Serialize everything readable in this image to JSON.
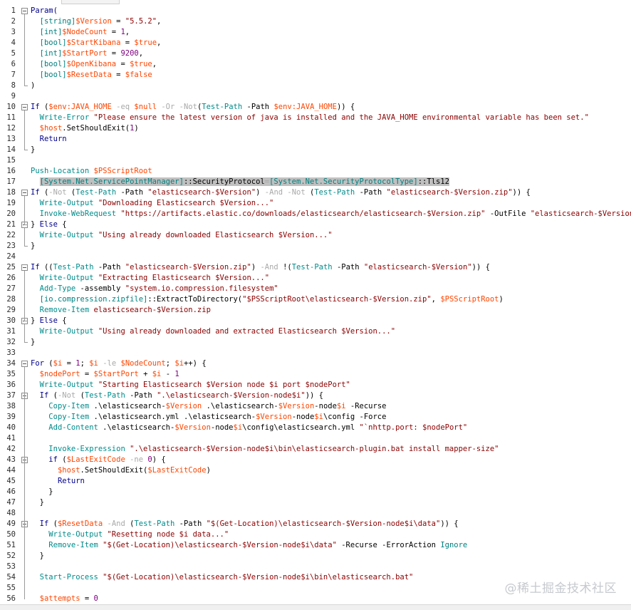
{
  "watermark": "@稀土掘金技术社区",
  "lines": [
    {
      "n": "1",
      "t": [
        [
          "Param(",
          "kw"
        ]
      ]
    },
    {
      "n": "2",
      "t": [
        [
          "  ",
          ""
        ],
        [
          "[string]",
          "typ"
        ],
        [
          "$Version",
          "var"
        ],
        [
          " = ",
          ""
        ],
        [
          "\"5.5.2\"",
          "str"
        ],
        [
          ",",
          ""
        ]
      ]
    },
    {
      "n": "3",
      "t": [
        [
          "  ",
          ""
        ],
        [
          "[int]",
          "typ"
        ],
        [
          "$NodeCount",
          "var"
        ],
        [
          " = ",
          ""
        ],
        [
          "1",
          "num"
        ],
        [
          ",",
          ""
        ]
      ]
    },
    {
      "n": "4",
      "t": [
        [
          "  ",
          ""
        ],
        [
          "[bool]",
          "typ"
        ],
        [
          "$StartKibana",
          "var"
        ],
        [
          " = ",
          ""
        ],
        [
          "$true",
          "var"
        ],
        [
          ",",
          ""
        ]
      ]
    },
    {
      "n": "5",
      "t": [
        [
          "  ",
          ""
        ],
        [
          "[int]",
          "typ"
        ],
        [
          "$StartPort",
          "var"
        ],
        [
          " = ",
          ""
        ],
        [
          "9200",
          "num"
        ],
        [
          ",",
          ""
        ]
      ]
    },
    {
      "n": "6",
      "t": [
        [
          "  ",
          ""
        ],
        [
          "[bool]",
          "typ"
        ],
        [
          "$OpenKibana",
          "var"
        ],
        [
          " = ",
          ""
        ],
        [
          "$true",
          "var"
        ],
        [
          ",",
          ""
        ]
      ]
    },
    {
      "n": "7",
      "t": [
        [
          "  ",
          ""
        ],
        [
          "[bool]",
          "typ"
        ],
        [
          "$ResetData",
          "var"
        ],
        [
          " = ",
          ""
        ],
        [
          "$false",
          "var"
        ]
      ]
    },
    {
      "n": "8",
      "t": [
        [
          ")",
          ""
        ]
      ]
    },
    {
      "n": "9",
      "t": []
    },
    {
      "n": "10",
      "t": [
        [
          "If ",
          "kw"
        ],
        [
          "(",
          ""
        ],
        [
          "$env:JAVA_HOME",
          "var"
        ],
        [
          " -eq ",
          "op"
        ],
        [
          "$null",
          "var"
        ],
        [
          " -Or -Not",
          "op"
        ],
        [
          "(",
          ""
        ],
        [
          "Test-Path",
          "cm"
        ],
        [
          " -Path ",
          ""
        ],
        [
          "$env:JAVA_HOME",
          "var"
        ],
        [
          ")) {",
          ""
        ]
      ]
    },
    {
      "n": "11",
      "t": [
        [
          "  ",
          ""
        ],
        [
          "Write-Error",
          "cm"
        ],
        [
          " ",
          ""
        ],
        [
          "\"Please ensure the latest version of java is installed and the JAVA_HOME environmental variable has been set.\"",
          "str"
        ]
      ]
    },
    {
      "n": "12",
      "t": [
        [
          "  ",
          ""
        ],
        [
          "$host",
          "var"
        ],
        [
          ".SetShouldExit(",
          ""
        ],
        [
          "1",
          "num"
        ],
        [
          ")",
          ""
        ]
      ]
    },
    {
      "n": "13",
      "t": [
        [
          "  ",
          ""
        ],
        [
          "Return",
          "kw"
        ]
      ]
    },
    {
      "n": "14",
      "t": [
        [
          "}",
          ""
        ]
      ]
    },
    {
      "n": "15",
      "t": []
    },
    {
      "n": "16",
      "t": [
        [
          "Push-Location",
          "cm"
        ],
        [
          " ",
          ""
        ],
        [
          "$PSScriptRoot",
          "var"
        ]
      ]
    },
    {
      "n": "17",
      "t": [
        [
          "  ",
          ""
        ],
        [
          "[System.Net.ServicePointManager]",
          "typ hl"
        ],
        [
          "::SecurityProtocol",
          "mem hl"
        ],
        [
          "=",
          "op hl"
        ],
        [
          "[System.Net.SecurityProtocolType]",
          "typ hl"
        ],
        [
          "::Tls12",
          "mem hl"
        ]
      ]
    },
    {
      "n": "18",
      "t": [
        [
          "If ",
          "kw"
        ],
        [
          "(",
          ""
        ],
        [
          "-Not",
          "op"
        ],
        [
          " (",
          ""
        ],
        [
          "Test-Path",
          "cm"
        ],
        [
          " -Path ",
          ""
        ],
        [
          "\"elasticsearch-$Version\"",
          "str"
        ],
        [
          ") ",
          ""
        ],
        [
          "-And -Not",
          "op"
        ],
        [
          " (",
          ""
        ],
        [
          "Test-Path",
          "cm"
        ],
        [
          " -Path ",
          ""
        ],
        [
          "\"elasticsearch-$Version.zip\"",
          "str"
        ],
        [
          ")) {",
          ""
        ]
      ]
    },
    {
      "n": "19",
      "t": [
        [
          "  ",
          ""
        ],
        [
          "Write-Output",
          "cm"
        ],
        [
          " ",
          ""
        ],
        [
          "\"Downloading Elasticsearch $Version...\"",
          "str"
        ]
      ]
    },
    {
      "n": "20",
      "t": [
        [
          "  ",
          ""
        ],
        [
          "Invoke-WebRequest",
          "cm"
        ],
        [
          " ",
          ""
        ],
        [
          "\"https://artifacts.elastic.co/downloads/elasticsearch/elasticsearch-$Version.zip\"",
          "str"
        ],
        [
          " -OutFile ",
          ""
        ],
        [
          "\"elasticsearch-$Version.zip\"",
          "str"
        ]
      ]
    },
    {
      "n": "21",
      "t": [
        [
          "} ",
          ""
        ],
        [
          "Else",
          "kw"
        ],
        [
          " {",
          ""
        ]
      ]
    },
    {
      "n": "22",
      "t": [
        [
          "  ",
          ""
        ],
        [
          "Write-Output",
          "cm"
        ],
        [
          " ",
          ""
        ],
        [
          "\"Using already downloaded Elasticsearch $Version...\"",
          "str"
        ]
      ]
    },
    {
      "n": "23",
      "t": [
        [
          "}",
          ""
        ]
      ]
    },
    {
      "n": "24",
      "t": []
    },
    {
      "n": "25",
      "t": [
        [
          "If ",
          "kw"
        ],
        [
          "((",
          ""
        ],
        [
          "Test-Path",
          "cm"
        ],
        [
          " -Path ",
          ""
        ],
        [
          "\"elasticsearch-$Version.zip\"",
          "str"
        ],
        [
          ") ",
          ""
        ],
        [
          "-And",
          "op"
        ],
        [
          " !(",
          ""
        ],
        [
          "Test-Path",
          "cm"
        ],
        [
          " -Path ",
          ""
        ],
        [
          "\"elasticsearch-$Version\"",
          "str"
        ],
        [
          ")) {",
          ""
        ]
      ]
    },
    {
      "n": "26",
      "t": [
        [
          "  ",
          ""
        ],
        [
          "Write-Output",
          "cm"
        ],
        [
          " ",
          ""
        ],
        [
          "\"Extracting Elasticsearch $Version...\"",
          "str"
        ]
      ]
    },
    {
      "n": "27",
      "t": [
        [
          "  ",
          ""
        ],
        [
          "Add-Type",
          "cm"
        ],
        [
          " -assembly ",
          ""
        ],
        [
          "\"system.io.compression.filesystem\"",
          "str"
        ]
      ]
    },
    {
      "n": "28",
      "t": [
        [
          "  ",
          ""
        ],
        [
          "[io.compression.zipfile]",
          "typ"
        ],
        [
          "::ExtractToDirectory(",
          ""
        ],
        [
          "\"$PSScriptRoot\\elasticsearch-$Version.zip\"",
          "str"
        ],
        [
          ", ",
          ""
        ],
        [
          "$PSScriptRoot",
          "var"
        ],
        [
          ")",
          ""
        ]
      ]
    },
    {
      "n": "29",
      "t": [
        [
          "  ",
          ""
        ],
        [
          "Remove-Item",
          "cm"
        ],
        [
          " ",
          ""
        ],
        [
          "elasticsearch-$Version.zip",
          "str"
        ]
      ]
    },
    {
      "n": "30",
      "t": [
        [
          "} ",
          ""
        ],
        [
          "Else",
          "kw"
        ],
        [
          " {",
          ""
        ]
      ]
    },
    {
      "n": "31",
      "t": [
        [
          "  ",
          ""
        ],
        [
          "Write-Output",
          "cm"
        ],
        [
          " ",
          ""
        ],
        [
          "\"Using already downloaded and extracted Elasticsearch $Version...\"",
          "str"
        ]
      ]
    },
    {
      "n": "32",
      "t": [
        [
          "}",
          ""
        ]
      ]
    },
    {
      "n": "33",
      "t": []
    },
    {
      "n": "34",
      "t": [
        [
          "For ",
          "kw"
        ],
        [
          "(",
          ""
        ],
        [
          "$i",
          "var"
        ],
        [
          " = ",
          ""
        ],
        [
          "1",
          "num"
        ],
        [
          "; ",
          ""
        ],
        [
          "$i",
          "var"
        ],
        [
          " -le ",
          "op"
        ],
        [
          "$NodeCount",
          "var"
        ],
        [
          "; ",
          ""
        ],
        [
          "$i",
          "var"
        ],
        [
          "++) {",
          ""
        ]
      ]
    },
    {
      "n": "35",
      "t": [
        [
          "  ",
          ""
        ],
        [
          "$nodePort",
          "var"
        ],
        [
          " = ",
          ""
        ],
        [
          "$StartPort",
          "var"
        ],
        [
          " + ",
          ""
        ],
        [
          "$i",
          "var"
        ],
        [
          " - ",
          ""
        ],
        [
          "1",
          "num"
        ]
      ]
    },
    {
      "n": "36",
      "t": [
        [
          "  ",
          ""
        ],
        [
          "Write-Output",
          "cm"
        ],
        [
          " ",
          ""
        ],
        [
          "\"Starting Elasticsearch $Version node $i port $nodePort\"",
          "str"
        ]
      ]
    },
    {
      "n": "37",
      "t": [
        [
          "  ",
          ""
        ],
        [
          "If ",
          "kw"
        ],
        [
          "(",
          ""
        ],
        [
          "-Not",
          "op"
        ],
        [
          " (",
          ""
        ],
        [
          "Test-Path",
          "cm"
        ],
        [
          " -Path ",
          ""
        ],
        [
          "\".\\elasticsearch-$Version-node$i\"",
          "str"
        ],
        [
          ")) {",
          ""
        ]
      ]
    },
    {
      "n": "38",
      "t": [
        [
          "    ",
          ""
        ],
        [
          "Copy-Item",
          "cm"
        ],
        [
          " .\\elasticsearch-",
          ""
        ],
        [
          "$Version",
          "var"
        ],
        [
          " .\\elasticsearch-",
          ""
        ],
        [
          "$Version",
          "var"
        ],
        [
          "-node",
          ""
        ],
        [
          "$i",
          "var"
        ],
        [
          " -Recurse",
          ""
        ]
      ]
    },
    {
      "n": "39",
      "t": [
        [
          "    ",
          ""
        ],
        [
          "Copy-Item",
          "cm"
        ],
        [
          " .\\elasticsearch.yml .\\elasticsearch-",
          ""
        ],
        [
          "$Version",
          "var"
        ],
        [
          "-node",
          ""
        ],
        [
          "$i",
          "var"
        ],
        [
          "\\config -Force",
          ""
        ]
      ]
    },
    {
      "n": "40",
      "t": [
        [
          "    ",
          ""
        ],
        [
          "Add-Content",
          "cm"
        ],
        [
          " .\\elasticsearch-",
          ""
        ],
        [
          "$Version",
          "var"
        ],
        [
          "-node",
          ""
        ],
        [
          "$i",
          "var"
        ],
        [
          "\\config\\elasticsearch.yml ",
          ""
        ],
        [
          "\"`nhttp.port: $nodePort\"",
          "str"
        ]
      ]
    },
    {
      "n": "41",
      "t": []
    },
    {
      "n": "42",
      "t": [
        [
          "    ",
          ""
        ],
        [
          "Invoke-Expression",
          "cm"
        ],
        [
          " ",
          ""
        ],
        [
          "\".\\elasticsearch-$Version-node$i\\bin\\elasticsearch-plugin.bat install mapper-size\"",
          "str"
        ]
      ]
    },
    {
      "n": "43",
      "t": [
        [
          "    ",
          ""
        ],
        [
          "if ",
          "kw"
        ],
        [
          "(",
          ""
        ],
        [
          "$LastExitCode",
          "var"
        ],
        [
          " -ne ",
          "op"
        ],
        [
          "0",
          "num"
        ],
        [
          ") {",
          ""
        ]
      ]
    },
    {
      "n": "44",
      "t": [
        [
          "      ",
          ""
        ],
        [
          "$host",
          "var"
        ],
        [
          ".SetShouldExit(",
          ""
        ],
        [
          "$LastExitCode",
          "var"
        ],
        [
          ")",
          ""
        ]
      ]
    },
    {
      "n": "45",
      "t": [
        [
          "      ",
          ""
        ],
        [
          "Return",
          "kw"
        ]
      ]
    },
    {
      "n": "46",
      "t": [
        [
          "    }",
          ""
        ]
      ]
    },
    {
      "n": "47",
      "t": [
        [
          "  }",
          ""
        ]
      ]
    },
    {
      "n": "48",
      "t": []
    },
    {
      "n": "49",
      "t": [
        [
          "  ",
          ""
        ],
        [
          "If ",
          "kw"
        ],
        [
          "(",
          ""
        ],
        [
          "$ResetData",
          "var"
        ],
        [
          " -And ",
          "op"
        ],
        [
          "(",
          ""
        ],
        [
          "Test-Path",
          "cm"
        ],
        [
          " -Path ",
          ""
        ],
        [
          "\"$(Get-Location)\\elasticsearch-$Version-node$i\\data\"",
          "str"
        ],
        [
          ")) {",
          ""
        ]
      ]
    },
    {
      "n": "50",
      "t": [
        [
          "    ",
          ""
        ],
        [
          "Write-Output",
          "cm"
        ],
        [
          " ",
          ""
        ],
        [
          "\"Resetting node $i data...\"",
          "str"
        ]
      ]
    },
    {
      "n": "51",
      "t": [
        [
          "    ",
          ""
        ],
        [
          "Remove-Item",
          "cm"
        ],
        [
          " ",
          ""
        ],
        [
          "\"$(Get-Location)\\elasticsearch-$Version-node$i\\data\"",
          "str"
        ],
        [
          " -Recurse -ErrorAction ",
          ""
        ],
        [
          "Ignore",
          "typ"
        ]
      ]
    },
    {
      "n": "52",
      "t": [
        [
          "  }",
          ""
        ]
      ]
    },
    {
      "n": "53",
      "t": []
    },
    {
      "n": "54",
      "t": [
        [
          "  ",
          ""
        ],
        [
          "Start-Process",
          "cm"
        ],
        [
          " ",
          ""
        ],
        [
          "\"$(Get-Location)\\elasticsearch-$Version-node$i\\bin\\elasticsearch.bat\"",
          "str"
        ]
      ]
    },
    {
      "n": "55",
      "t": []
    },
    {
      "n": "56",
      "t": [
        [
          "  ",
          ""
        ],
        [
          "$attempts",
          "var"
        ],
        [
          " = ",
          ""
        ],
        [
          "0",
          "num"
        ]
      ]
    }
  ],
  "folds": [
    "1",
    "10",
    "18",
    "21",
    "25",
    "30",
    "34",
    "37",
    "43",
    "49"
  ],
  "colors": {
    "keyword": "#00008b",
    "cmdlet": "#008b8b",
    "string": "#8b0000",
    "variable": "#ff4500",
    "type": "#008080",
    "highlight": "#c0c0c0"
  }
}
